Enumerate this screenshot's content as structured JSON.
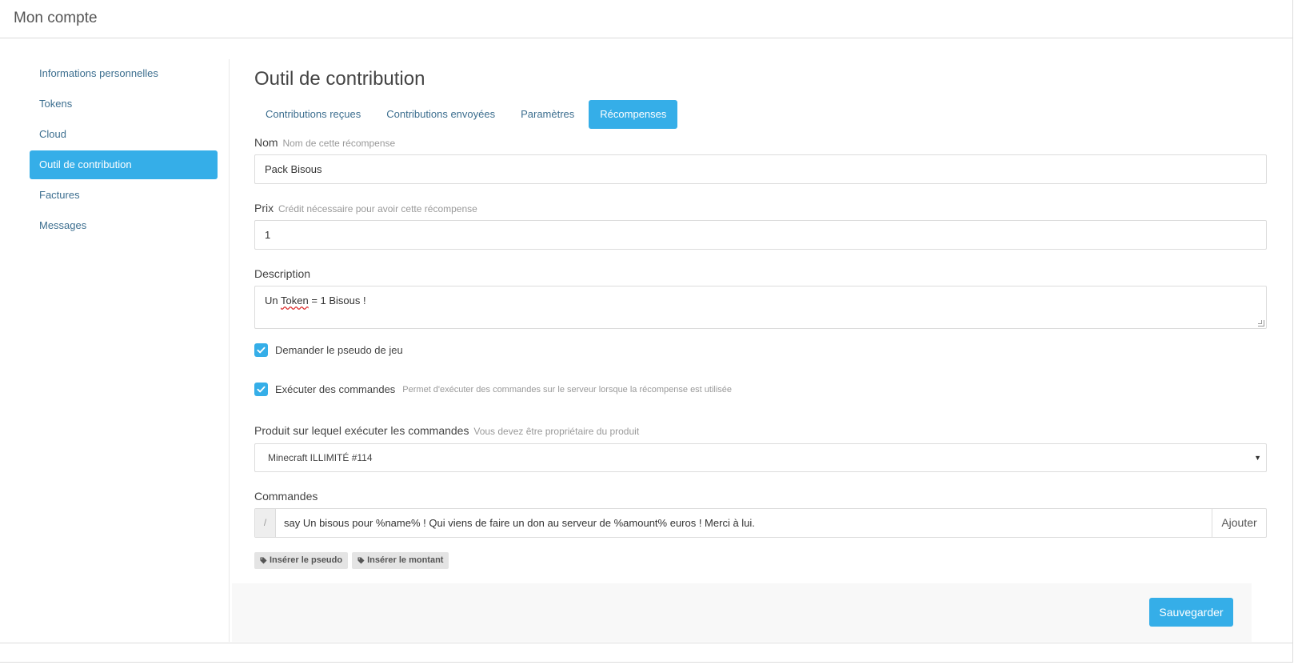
{
  "header": {
    "title": "Mon compte"
  },
  "sidebar": {
    "items": [
      {
        "label": "Informations personnelles",
        "active": false
      },
      {
        "label": "Tokens",
        "active": false
      },
      {
        "label": "Cloud",
        "active": false
      },
      {
        "label": "Outil de contribution",
        "active": true
      },
      {
        "label": "Factures",
        "active": false
      },
      {
        "label": "Messages",
        "active": false
      }
    ]
  },
  "main": {
    "title": "Outil de contribution",
    "tabs": [
      {
        "label": "Contributions reçues",
        "active": false
      },
      {
        "label": "Contributions envoyées",
        "active": false
      },
      {
        "label": "Paramètres",
        "active": false
      },
      {
        "label": "Récompenses",
        "active": true
      }
    ]
  },
  "form": {
    "name": {
      "label": "Nom",
      "hint": "Nom de cette récompense",
      "value": "Pack Bisous"
    },
    "price": {
      "label": "Prix",
      "hint": "Crédit nécessaire pour avoir cette récompense",
      "value": "1"
    },
    "description": {
      "label": "Description",
      "value_before": "Un ",
      "value_spell": "Token",
      "value_after": " = 1 Bisous !"
    },
    "ask_pseudo": {
      "label": "Demander le pseudo de jeu",
      "checked": true
    },
    "run_commands": {
      "label": "Exécuter des commandes",
      "hint": "Permet d'exécuter des commandes sur le serveur lorsque la récompense est utilisée",
      "checked": true
    },
    "product": {
      "label": "Produit sur lequel exécuter les commandes",
      "hint": "Vous devez être propriétaire du produit",
      "selected": "Minecraft ILLIMITÉ #114"
    },
    "commands": {
      "label": "Commandes",
      "prefix": "/",
      "value": "say Un bisous pour %name% ! Qui viens de faire un don au serveur de %amount% euros ! Merci à lui.",
      "add_label": "Ajouter"
    },
    "tags": [
      {
        "label": "Insérer le pseudo",
        "icon": "tag-icon"
      },
      {
        "label": "Insérer le montant",
        "icon": "tag-icon"
      }
    ],
    "save_label": "Sauvegarder"
  },
  "colors": {
    "accent": "#35aee8",
    "link": "#3c6e8f",
    "border": "#dcdcdc"
  }
}
